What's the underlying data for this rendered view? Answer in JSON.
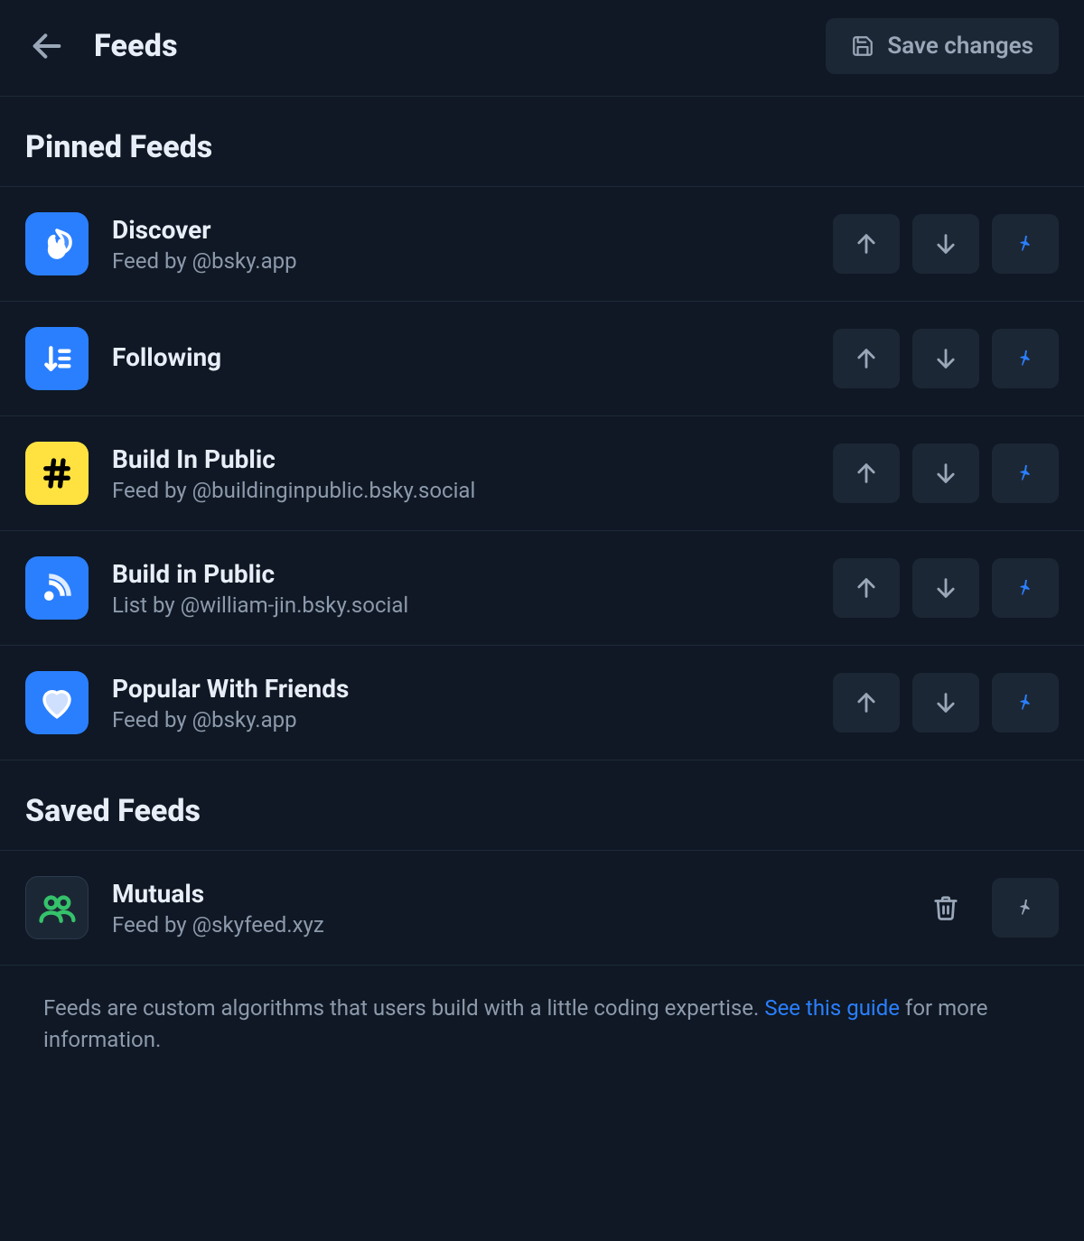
{
  "header": {
    "title": "Feeds",
    "save_label": "Save changes"
  },
  "sections": {
    "pinned_title": "Pinned Feeds",
    "saved_title": "Saved Feeds"
  },
  "pinned": [
    {
      "name": "Discover",
      "sub": "Feed by @bsky.app"
    },
    {
      "name": "Following",
      "sub": ""
    },
    {
      "name": "Build In Public",
      "sub": "Feed by @buildinginpublic.bsky.social"
    },
    {
      "name": "Build in Public",
      "sub": "List by @william-jin.bsky.social"
    },
    {
      "name": "Popular With Friends",
      "sub": "Feed by @bsky.app"
    }
  ],
  "saved": [
    {
      "name": "Mutuals",
      "sub": "Feed by @skyfeed.xyz"
    }
  ],
  "footer": {
    "text_before": "Feeds are custom algorithms that users build with a little coding expertise. ",
    "link_text": "See this guide",
    "text_after": " for more information."
  }
}
